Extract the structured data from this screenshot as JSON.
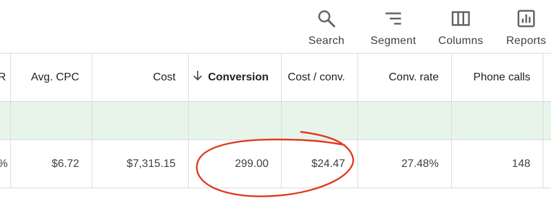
{
  "toolbar": {
    "search_label": "Search",
    "segment_label": "Segment",
    "columns_label": "Columns",
    "reports_label": "Reports"
  },
  "table": {
    "headers": {
      "partial": "R",
      "avg_cpc": "Avg. CPC",
      "cost": "Cost",
      "conversion": "Conversion",
      "cost_per_conv": "Cost / conv.",
      "conv_rate": "Conv. rate",
      "phone_calls": "Phone calls"
    },
    "sort": {
      "column": "Conversion",
      "direction": "descending"
    },
    "rows": [
      {
        "partial": "%",
        "avg_cpc": "$6.72",
        "cost": "$7,315.15",
        "conversion": "299.00",
        "cost_per_conv": "$24.47",
        "conv_rate": "27.48%",
        "phone_calls": "148"
      }
    ]
  },
  "colors": {
    "total_row_bg": "#e6f4ea",
    "border": "#dadce0",
    "annotation": "#e0391f"
  },
  "icons": [
    "search-icon",
    "segment-icon",
    "columns-icon",
    "reports-icon",
    "arrow-down-icon"
  ]
}
